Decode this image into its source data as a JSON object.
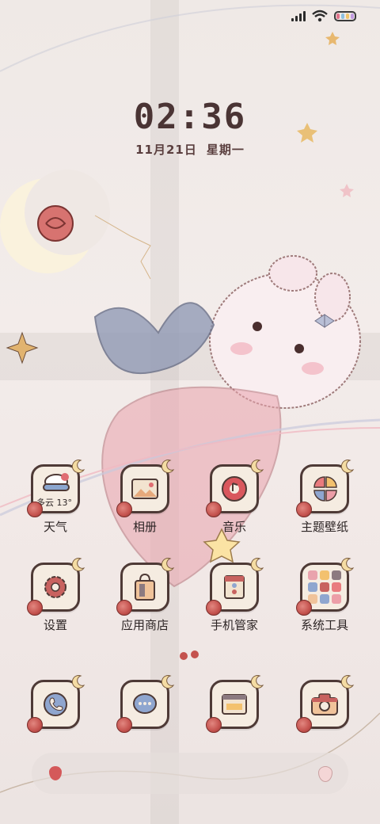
{
  "status_bar": {
    "signal_icon": "signal-bars-icon",
    "wifi_icon": "wifi-icon",
    "battery_icon": "battery-icon"
  },
  "clock": {
    "time": "02:36",
    "date": "11月21日",
    "weekday": "星期一"
  },
  "apps_row1": [
    {
      "label": "天气",
      "icon": "weather-icon",
      "widget_text": "多云 13°"
    },
    {
      "label": "相册",
      "icon": "gallery-icon"
    },
    {
      "label": "音乐",
      "icon": "music-icon"
    },
    {
      "label": "主题壁纸",
      "icon": "theme-icon"
    }
  ],
  "apps_row2": [
    {
      "label": "设置",
      "icon": "settings-icon"
    },
    {
      "label": "应用商店",
      "icon": "app-store-icon"
    },
    {
      "label": "手机管家",
      "icon": "phone-manager-icon"
    },
    {
      "label": "系统工具",
      "icon": "system-tools-folder-icon"
    }
  ],
  "dock": [
    {
      "icon": "phone-icon"
    },
    {
      "icon": "messages-icon"
    },
    {
      "icon": "browser-icon"
    },
    {
      "icon": "camera-icon"
    }
  ],
  "colors": {
    "accent": "#4e3a36",
    "tile_bg": "#f5ece1",
    "rose": "#c4524e"
  }
}
